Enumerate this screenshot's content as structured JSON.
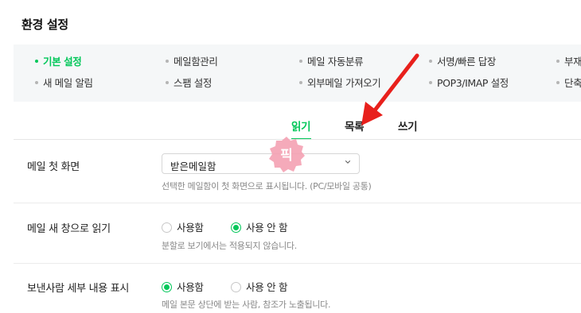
{
  "page": {
    "title": "환경 설정"
  },
  "menu": {
    "row1": [
      {
        "label": "기본 설정",
        "active": true
      },
      {
        "label": "메일함관리",
        "active": false
      },
      {
        "label": "메일 자동분류",
        "active": false
      },
      {
        "label": "서명/빠른 답장",
        "active": false
      },
      {
        "label": "부재",
        "active": false
      }
    ],
    "row2": [
      {
        "label": "새 메일 알림",
        "active": false
      },
      {
        "label": "스팸 설정",
        "active": false
      },
      {
        "label": "외부메일 가져오기",
        "active": false
      },
      {
        "label": "POP3/IMAP 설정",
        "active": false
      },
      {
        "label": "단축",
        "active": false
      }
    ]
  },
  "tabs": [
    {
      "label": "읽기",
      "active": true
    },
    {
      "label": "목록",
      "active": false
    },
    {
      "label": "쓰기",
      "active": false
    }
  ],
  "settings": {
    "first_screen": {
      "label": "메일 첫 화면",
      "value": "받은메일함",
      "help": "선택한 메일함이 첫 화면으로 표시됩니다. (PC/모바일 공통)"
    },
    "new_window": {
      "label": "메일 새 창으로 읽기",
      "options": [
        "사용함",
        "사용 안 함"
      ],
      "selected": 1,
      "help": "분할로 보기에서는 적용되지 않습니다."
    },
    "sender_detail": {
      "label": "보낸사람 세부 내용 표시",
      "options": [
        "사용함",
        "사용 안 함"
      ],
      "selected": 0,
      "help": "메일 본문 상단에 받는 사람, 참조가 노출됩니다."
    }
  },
  "overlay": {
    "badge_text": "픽",
    "badge_color": "#f4a1b2",
    "arrow_color": "#e8201c"
  },
  "colors": {
    "accent": "#03c75a",
    "menu_bg": "#f5f7f8"
  }
}
